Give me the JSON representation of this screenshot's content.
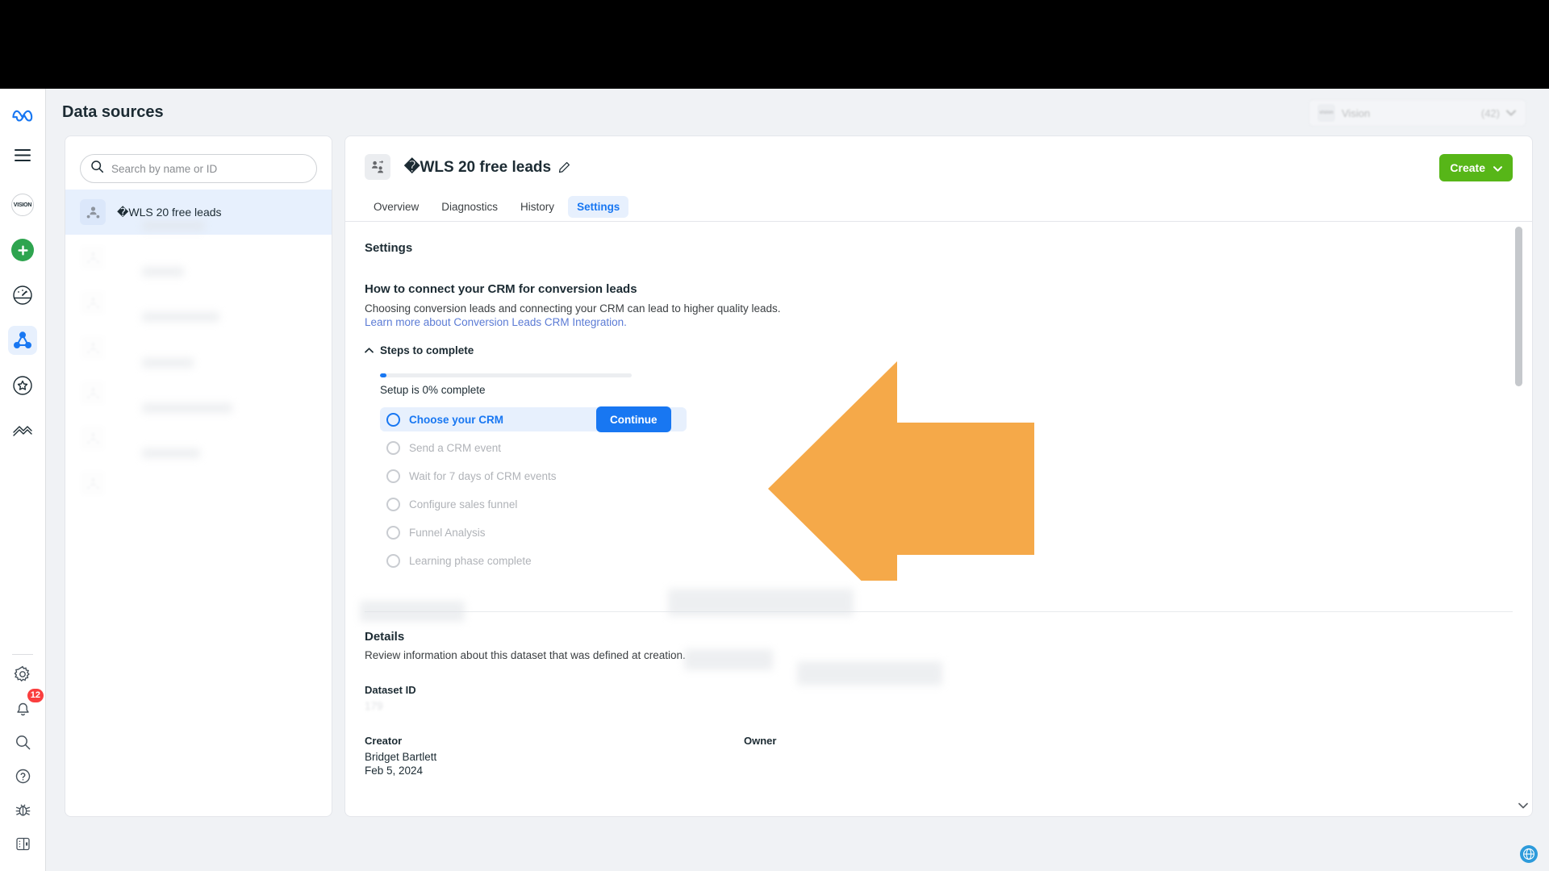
{
  "page": {
    "title": "Data sources"
  },
  "account_switcher": {
    "thumb_label": "vision",
    "name": "Vision",
    "id": "(42)",
    "caret_icon": "chevron-down-icon"
  },
  "rail": {
    "items": [
      {
        "name": "meta-logo",
        "label": "Meta"
      },
      {
        "name": "menu-icon",
        "label": "Menu"
      },
      {
        "name": "vision-account-avatar",
        "label": "VISION"
      },
      {
        "name": "create-icon",
        "label": "Create"
      },
      {
        "name": "ads-manager-icon",
        "label": "Ads Manager"
      },
      {
        "name": "events-manager-icon",
        "label": "Events Manager"
      },
      {
        "name": "audiences-icon",
        "label": "Audiences"
      },
      {
        "name": "billing-icon",
        "label": "Billing"
      }
    ],
    "bottom_items": [
      {
        "name": "gear-icon",
        "label": "Settings"
      },
      {
        "name": "bell-icon",
        "label": "Notifications",
        "badge": "12"
      },
      {
        "name": "search-icon",
        "label": "Search"
      },
      {
        "name": "help-icon",
        "label": "Help"
      },
      {
        "name": "bug-icon",
        "label": "Report a bug"
      },
      {
        "name": "panel-toggle-icon",
        "label": "Collapse panel"
      }
    ]
  },
  "search": {
    "placeholder": "Search by name or ID",
    "value": "",
    "icon": "search-icon"
  },
  "dataset_list": [
    {
      "label": "�WLS 20 free leads",
      "selected": true
    },
    {
      "label": "",
      "selected": false
    },
    {
      "label": "",
      "selected": false
    },
    {
      "label": "",
      "selected": false
    },
    {
      "label": "",
      "selected": false
    },
    {
      "label": "",
      "selected": false
    },
    {
      "label": "",
      "selected": false
    }
  ],
  "detail": {
    "asset_name": "�WLS 20 free leads",
    "edit_icon": "pencil-icon",
    "thumb_icon": "leads-dataset-icon",
    "create_label": "Create",
    "create_caret": "chevron-down-icon",
    "tabs": [
      {
        "label": "Overview",
        "active": false
      },
      {
        "label": "Diagnostics",
        "active": false
      },
      {
        "label": "History",
        "active": false
      },
      {
        "label": "Settings",
        "active": true
      }
    ]
  },
  "settings": {
    "heading": "Settings",
    "crm": {
      "heading": "How to connect your CRM for conversion leads",
      "description": "Choosing conversion leads and connecting your CRM can lead to higher quality leads.",
      "link_text": "Learn more about Conversion Leads CRM Integration.",
      "steps_toggle_label": "Steps to complete",
      "steps_toggle_icon": "chevron-up-icon",
      "progress_label": "Setup is 0% complete",
      "progress_percent": 0,
      "continue_label": "Continue",
      "steps": [
        {
          "label": "Choose your CRM",
          "state": "current"
        },
        {
          "label": "Send a CRM event",
          "state": "pending"
        },
        {
          "label": "Wait for 7 days of CRM events",
          "state": "pending"
        },
        {
          "label": "Configure sales funnel",
          "state": "pending"
        },
        {
          "label": "Funnel Analysis",
          "state": "pending"
        },
        {
          "label": "Learning phase complete",
          "state": "pending"
        }
      ]
    },
    "details": {
      "heading": "Details",
      "subtitle": "Review information about this dataset that was defined at creation.",
      "dataset_id_label": "Dataset ID",
      "dataset_id_value": "179",
      "creator_label": "Creator",
      "creator_name": "Bridget Bartlett",
      "creator_date": "Feb 5, 2024",
      "owner_label": "Owner"
    }
  },
  "colors": {
    "brand_blue": "#1877f2",
    "create_green": "#57b618",
    "badge_red": "#fa3e3e",
    "annotation_orange": "#f5a949",
    "step_disabled": "#b0b3b8"
  },
  "annotation": {
    "arrow_icon": "left-arrow-annotation",
    "color": "#f5a949"
  }
}
